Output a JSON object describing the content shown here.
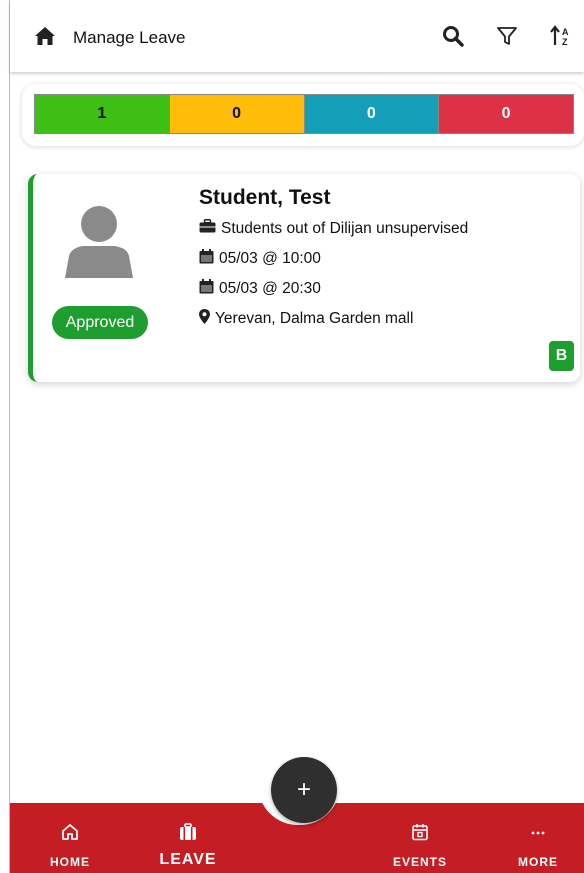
{
  "header": {
    "title": "Manage Leave",
    "icons": [
      "home-icon",
      "search-icon",
      "filter-icon",
      "sort-icon"
    ]
  },
  "summary": {
    "segments": [
      {
        "label": "1",
        "color": "#3dbf16",
        "text_color": "#111111"
      },
      {
        "label": "0",
        "color": "#ffbd09",
        "text_color": "#111111"
      },
      {
        "label": "0",
        "color": "#139fb8",
        "text_color": "#ffffff"
      },
      {
        "label": "0",
        "color": "#dd3145",
        "text_color": "#ffffff"
      }
    ]
  },
  "leave": {
    "name": "Student, Test",
    "status": "Approved",
    "status_color": "#1e9e2e",
    "reason": "Students out of Dilijan unsupervised",
    "start": "05/03 @ 10:00",
    "end": "05/03 @ 20:30",
    "location": "Yerevan, Dalma Garden mall",
    "house": "B"
  },
  "fab": {
    "label": "+"
  },
  "nav": {
    "color": "#c41e24",
    "home": "HOME",
    "leave": "LEAVE",
    "events": "EVENTS",
    "more": "MORE"
  }
}
